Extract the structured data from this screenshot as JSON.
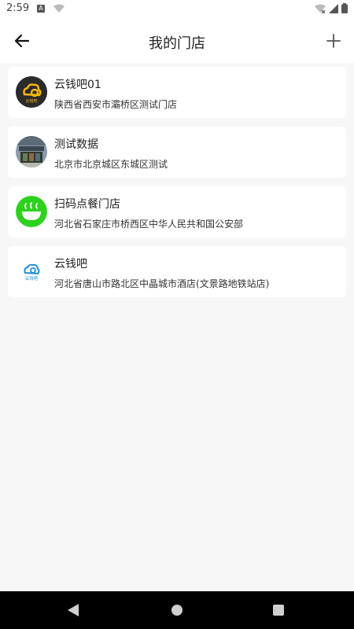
{
  "status": {
    "time": "2:59"
  },
  "header": {
    "title": "我的门店"
  },
  "stores": [
    {
      "name": "云钱吧01",
      "address": "陕西省西安市灞桥区测试门店",
      "avatar": "yunqianba-logo-yellow"
    },
    {
      "name": "测试数据",
      "address": "北京市北京城区东城区测试",
      "avatar": "storefront-photo"
    },
    {
      "name": "扫码点餐门店",
      "address": "河北省石家庄市桥西区中华人民共和国公安部",
      "avatar": "bowl-icon"
    },
    {
      "name": "云钱吧",
      "address": "河北省唐山市路北区中晶城市酒店(文景路地铁站店)",
      "avatar": "yunqianba-logo-blue"
    }
  ],
  "logo_text": {
    "small": "云钱吧"
  },
  "colors": {
    "accent_yellow": "#f5b70e",
    "bowl_green": "#2fd11f",
    "brand_blue": "#1e8fd8"
  }
}
